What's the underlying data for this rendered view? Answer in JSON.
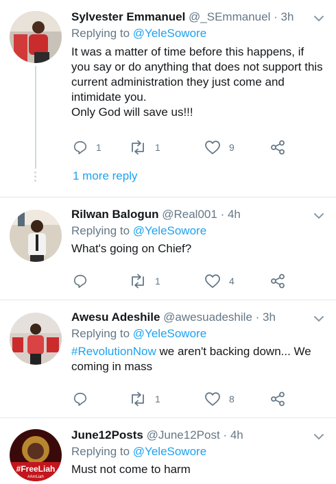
{
  "tweets": [
    {
      "name": "Sylvester Emmanuel",
      "handle": "@_SEmmanuel",
      "separator": "·",
      "time": "3h",
      "replying_prefix": "Replying to",
      "replying_to": "@YeleSowore",
      "body_lines": [
        "It was a matter of time before this happens, if",
        "you say or do anything that does not support this",
        "current administration they just come and",
        "intimidate you.",
        "Only God will save us!!!"
      ],
      "reply_count": "1",
      "retweet_count": "1",
      "like_count": "9",
      "more_replies": "1 more reply"
    },
    {
      "name": "Rilwan Balogun",
      "handle": "@Real001",
      "separator": "·",
      "time": "4h",
      "replying_prefix": "Replying to",
      "replying_to": "@YeleSowore",
      "body_lines": [
        "What's going on Chief?"
      ],
      "reply_count": "",
      "retweet_count": "1",
      "like_count": "4"
    },
    {
      "name": "Awesu Adeshile",
      "handle": "@awesuadeshile",
      "separator": "·",
      "time": "3h",
      "replying_prefix": "Replying to",
      "replying_to": "@YeleSowore",
      "hashtag": "#RevolutionNow",
      "body_first_rest": " we aren't backing down... We",
      "body_lines": [
        "coming in mass"
      ],
      "reply_count": "",
      "retweet_count": "1",
      "like_count": "8"
    },
    {
      "name": "June12Posts",
      "handle": "@June12Post",
      "separator": "·",
      "time": "4h",
      "replying_prefix": "Replying to",
      "replying_to": "@YeleSowore",
      "body_lines": [
        "Must not come to harm"
      ],
      "avatar_text": "#FreeLiah",
      "avatar_subtext": "#AmLiah"
    }
  ],
  "colors": {
    "accent": "#1da1f2",
    "secondary_text": "#657786",
    "divider": "#e1e8ed"
  },
  "icons": {
    "reply": "reply-icon",
    "retweet": "retweet-icon",
    "like": "heart-icon",
    "share": "share-icon",
    "menu": "chevron-down-icon"
  }
}
